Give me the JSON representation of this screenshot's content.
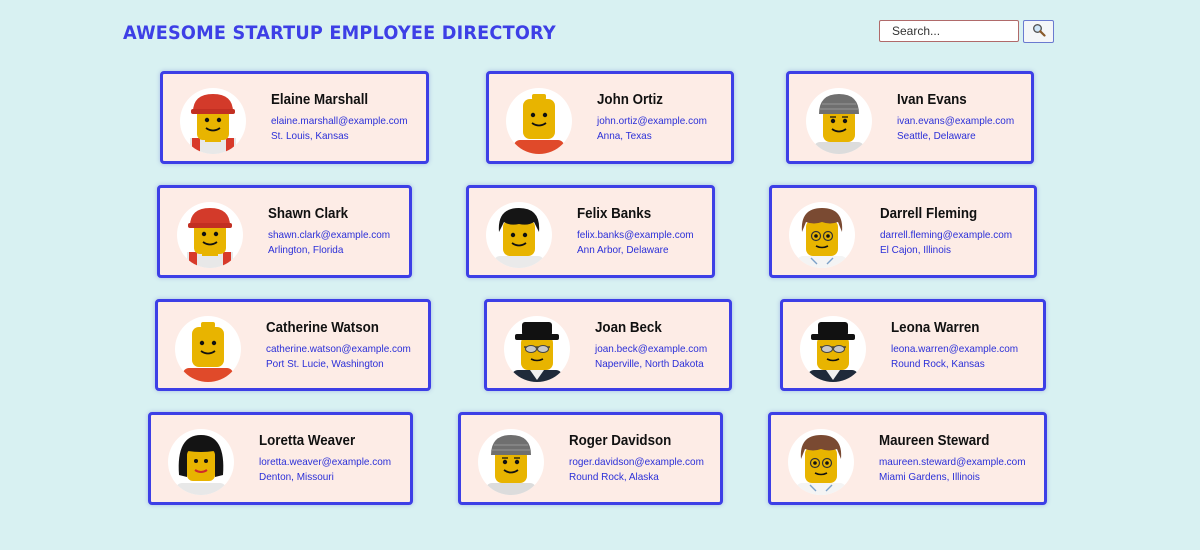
{
  "header": {
    "title": "AWESOME STARTUP EMPLOYEE DIRECTORY"
  },
  "search": {
    "placeholder": "Search...",
    "button_icon": "magnifier-icon"
  },
  "colors": {
    "background": "#d8f1f2",
    "accent": "#3d3fe6",
    "card": "#fdece6"
  },
  "employees": [
    {
      "name": "Elaine Marshall",
      "email": "elaine.marshall@example.com",
      "location": "St. Louis, Kansas",
      "avatar": "hard-hat-minifig"
    },
    {
      "name": "John Ortiz",
      "email": "john.ortiz@example.com",
      "location": "Anna, Texas",
      "avatar": "bald-minifig"
    },
    {
      "name": "Ivan Evans",
      "email": "ivan.evans@example.com",
      "location": "Seattle, Delaware",
      "avatar": "gray-cap-minifig"
    },
    {
      "name": "Shawn Clark",
      "email": "shawn.clark@example.com",
      "location": "Arlington, Florida",
      "avatar": "hard-hat-minifig"
    },
    {
      "name": "Felix Banks",
      "email": "felix.banks@example.com",
      "location": "Ann Arbor, Delaware",
      "avatar": "black-hair-minifig"
    },
    {
      "name": "Darrell Fleming",
      "email": "darrell.fleming@example.com",
      "location": "El Cajon, Illinois",
      "avatar": "brown-hair-glasses-minifig"
    },
    {
      "name": "Catherine Watson",
      "email": "catherine.watson@example.com",
      "location": "Port St. Lucie, Washington",
      "avatar": "bald-minifig"
    },
    {
      "name": "Joan Beck",
      "email": "joan.beck@example.com",
      "location": "Naperville, North Dakota",
      "avatar": "black-hat-sunglasses-minifig"
    },
    {
      "name": "Leona Warren",
      "email": "leona.warren@example.com",
      "location": "Round Rock, Kansas",
      "avatar": "black-hat-sunglasses-minifig"
    },
    {
      "name": "Loretta Weaver",
      "email": "loretta.weaver@example.com",
      "location": "Denton, Missouri",
      "avatar": "long-black-hair-minifig"
    },
    {
      "name": "Roger Davidson",
      "email": "roger.davidson@example.com",
      "location": "Round Rock, Alaska",
      "avatar": "gray-cap-minifig"
    },
    {
      "name": "Maureen Steward",
      "email": "maureen.steward@example.com",
      "location": "Miami Gardens, Illinois",
      "avatar": "brown-hair-glasses-minifig"
    }
  ]
}
